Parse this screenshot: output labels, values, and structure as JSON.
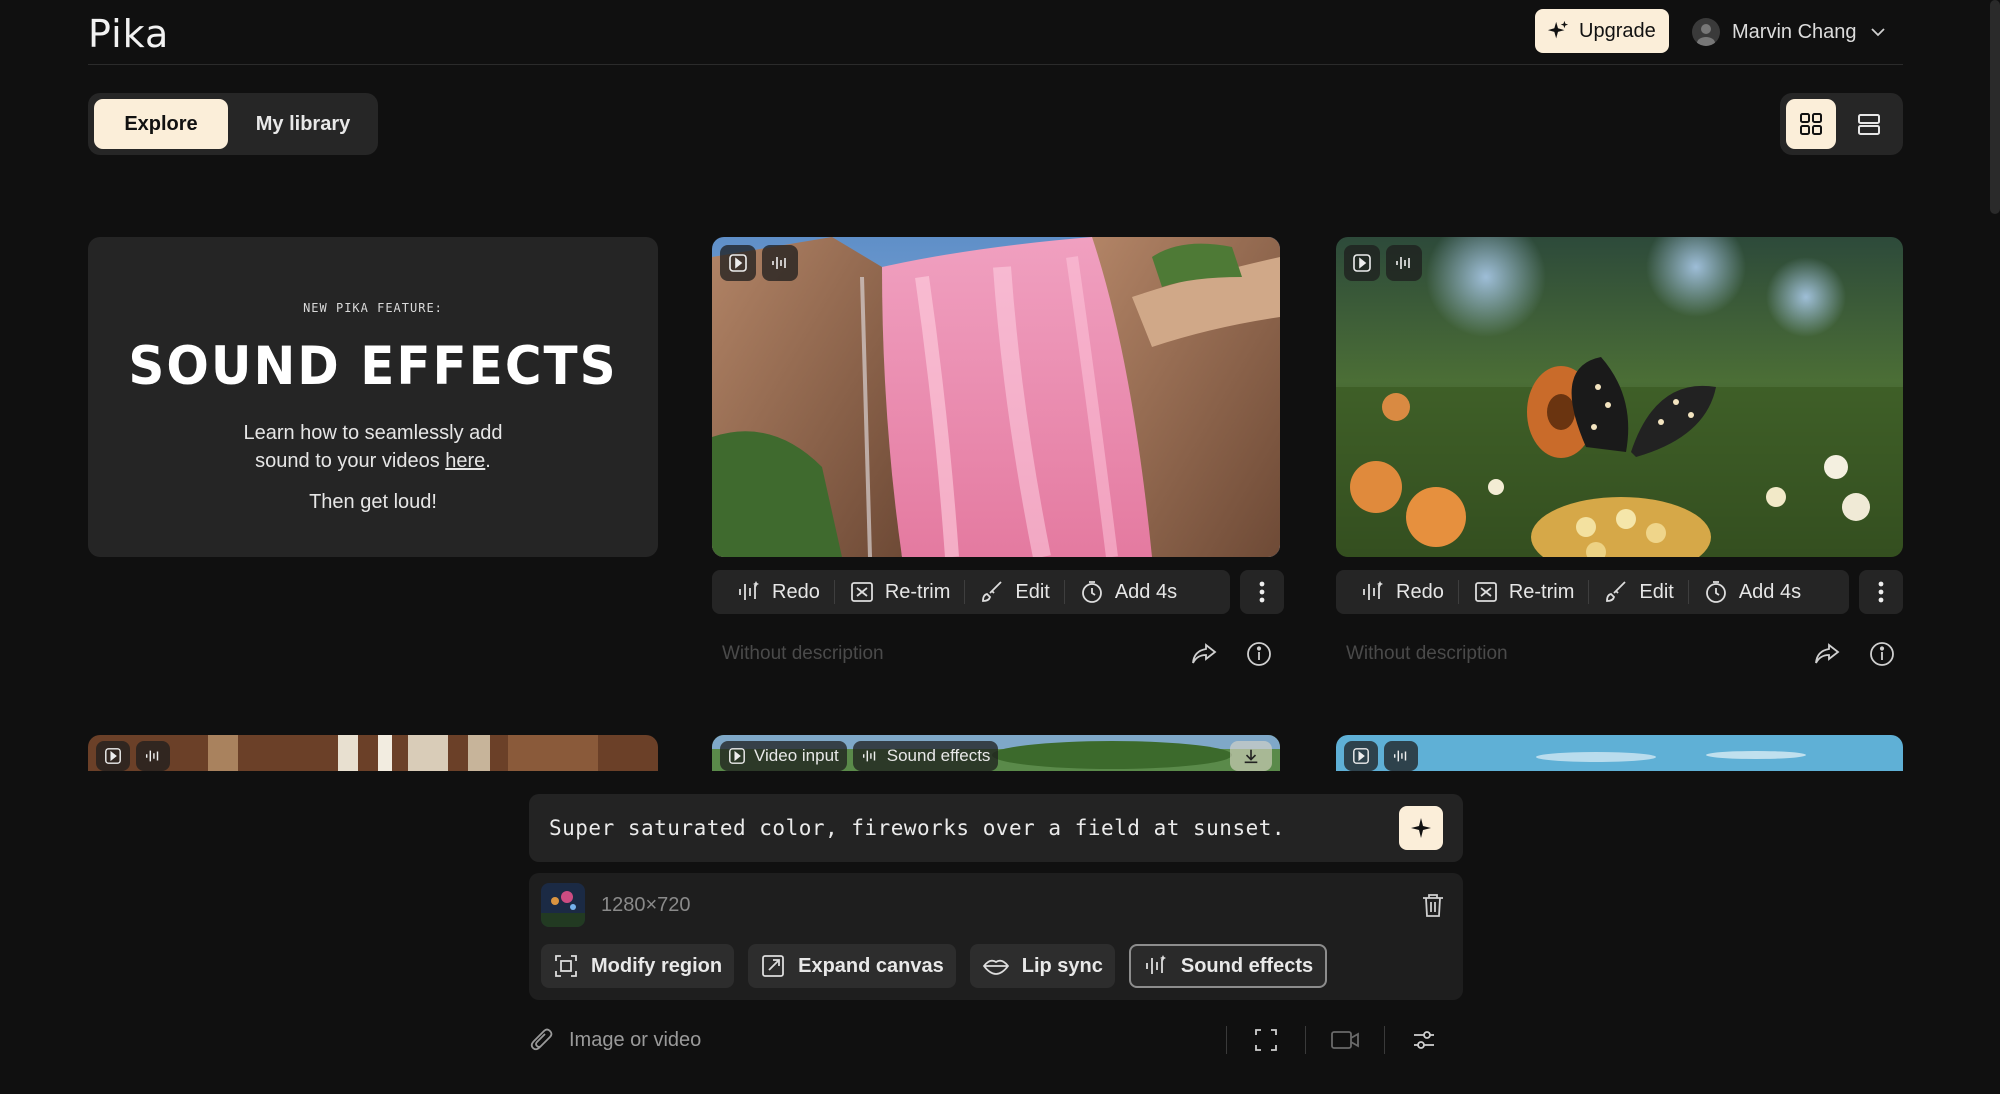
{
  "app": {
    "logo_text": "Pika",
    "upgrade_label": "Upgrade",
    "user_name": "Marvin Chang"
  },
  "tabs": [
    {
      "label": "Explore",
      "active": true
    },
    {
      "label": "My library",
      "active": false
    }
  ],
  "view_toggle": {
    "grid_icon": "grid-icon",
    "list_icon": "list-icon",
    "active": "grid"
  },
  "feature_card": {
    "kicker": "NEW PIKA FEATURE:",
    "title": "SOUND EFFECTS",
    "body_line1": "Learn how to seamlessly add",
    "body_line2_prefix": "sound to your videos ",
    "link": "here",
    "body_line2_suffix": ".",
    "closing": "Then get loud!"
  },
  "video_cards": [
    {
      "id": "waterfall",
      "actions": {
        "redo": "Redo",
        "retrim": "Re-trim",
        "edit": "Edit",
        "add": "Add 4s"
      },
      "description": "Without description"
    },
    {
      "id": "butterfly",
      "actions": {
        "redo": "Redo",
        "retrim": "Re-trim",
        "edit": "Edit",
        "add": "Add 4s"
      },
      "description": "Without description"
    }
  ],
  "row2_badges": {
    "video_input": "Video input",
    "sound_effects": "Sound effects"
  },
  "composer": {
    "prompt": "Super saturated color, fireworks over a field at sunset.",
    "media_size": "1280×720",
    "chips": [
      {
        "label": "Modify region",
        "icon": "modify-region-icon",
        "selected": false
      },
      {
        "label": "Expand canvas",
        "icon": "expand-canvas-icon",
        "selected": false
      },
      {
        "label": "Lip sync",
        "icon": "lips-icon",
        "selected": false
      },
      {
        "label": "Sound effects",
        "icon": "sound-wave-icon",
        "selected": true
      }
    ],
    "attach_label": "Image or video"
  },
  "colors": {
    "accent": "#fbeed9",
    "background": "#101010",
    "panel": "#252525"
  }
}
